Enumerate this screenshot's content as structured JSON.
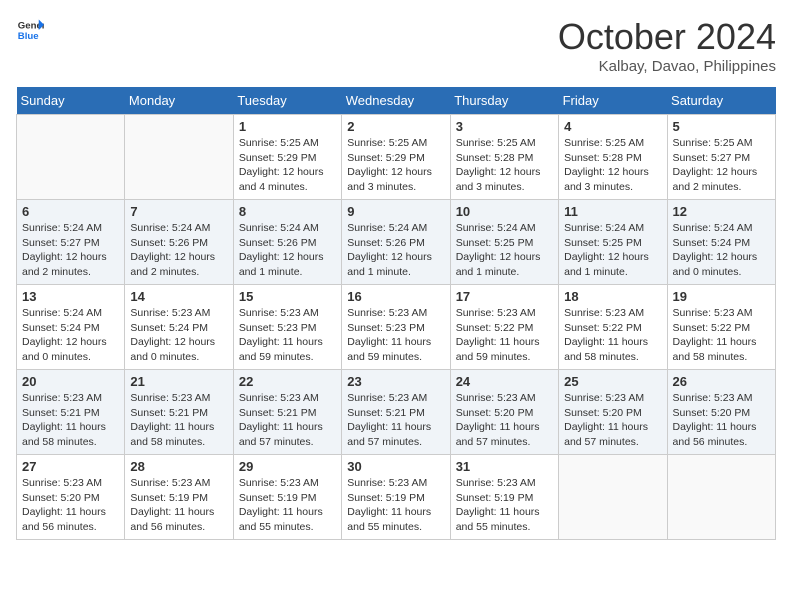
{
  "header": {
    "logo_line1": "General",
    "logo_line2": "Blue",
    "month": "October 2024",
    "location": "Kalbay, Davao, Philippines"
  },
  "weekdays": [
    "Sunday",
    "Monday",
    "Tuesday",
    "Wednesday",
    "Thursday",
    "Friday",
    "Saturday"
  ],
  "weeks": [
    [
      {
        "day": "",
        "info": ""
      },
      {
        "day": "",
        "info": ""
      },
      {
        "day": "1",
        "info": "Sunrise: 5:25 AM\nSunset: 5:29 PM\nDaylight: 12 hours and 4 minutes."
      },
      {
        "day": "2",
        "info": "Sunrise: 5:25 AM\nSunset: 5:29 PM\nDaylight: 12 hours and 3 minutes."
      },
      {
        "day": "3",
        "info": "Sunrise: 5:25 AM\nSunset: 5:28 PM\nDaylight: 12 hours and 3 minutes."
      },
      {
        "day": "4",
        "info": "Sunrise: 5:25 AM\nSunset: 5:28 PM\nDaylight: 12 hours and 3 minutes."
      },
      {
        "day": "5",
        "info": "Sunrise: 5:25 AM\nSunset: 5:27 PM\nDaylight: 12 hours and 2 minutes."
      }
    ],
    [
      {
        "day": "6",
        "info": "Sunrise: 5:24 AM\nSunset: 5:27 PM\nDaylight: 12 hours and 2 minutes."
      },
      {
        "day": "7",
        "info": "Sunrise: 5:24 AM\nSunset: 5:26 PM\nDaylight: 12 hours and 2 minutes."
      },
      {
        "day": "8",
        "info": "Sunrise: 5:24 AM\nSunset: 5:26 PM\nDaylight: 12 hours and 1 minute."
      },
      {
        "day": "9",
        "info": "Sunrise: 5:24 AM\nSunset: 5:26 PM\nDaylight: 12 hours and 1 minute."
      },
      {
        "day": "10",
        "info": "Sunrise: 5:24 AM\nSunset: 5:25 PM\nDaylight: 12 hours and 1 minute."
      },
      {
        "day": "11",
        "info": "Sunrise: 5:24 AM\nSunset: 5:25 PM\nDaylight: 12 hours and 1 minute."
      },
      {
        "day": "12",
        "info": "Sunrise: 5:24 AM\nSunset: 5:24 PM\nDaylight: 12 hours and 0 minutes."
      }
    ],
    [
      {
        "day": "13",
        "info": "Sunrise: 5:24 AM\nSunset: 5:24 PM\nDaylight: 12 hours and 0 minutes."
      },
      {
        "day": "14",
        "info": "Sunrise: 5:23 AM\nSunset: 5:24 PM\nDaylight: 12 hours and 0 minutes."
      },
      {
        "day": "15",
        "info": "Sunrise: 5:23 AM\nSunset: 5:23 PM\nDaylight: 11 hours and 59 minutes."
      },
      {
        "day": "16",
        "info": "Sunrise: 5:23 AM\nSunset: 5:23 PM\nDaylight: 11 hours and 59 minutes."
      },
      {
        "day": "17",
        "info": "Sunrise: 5:23 AM\nSunset: 5:22 PM\nDaylight: 11 hours and 59 minutes."
      },
      {
        "day": "18",
        "info": "Sunrise: 5:23 AM\nSunset: 5:22 PM\nDaylight: 11 hours and 58 minutes."
      },
      {
        "day": "19",
        "info": "Sunrise: 5:23 AM\nSunset: 5:22 PM\nDaylight: 11 hours and 58 minutes."
      }
    ],
    [
      {
        "day": "20",
        "info": "Sunrise: 5:23 AM\nSunset: 5:21 PM\nDaylight: 11 hours and 58 minutes."
      },
      {
        "day": "21",
        "info": "Sunrise: 5:23 AM\nSunset: 5:21 PM\nDaylight: 11 hours and 58 minutes."
      },
      {
        "day": "22",
        "info": "Sunrise: 5:23 AM\nSunset: 5:21 PM\nDaylight: 11 hours and 57 minutes."
      },
      {
        "day": "23",
        "info": "Sunrise: 5:23 AM\nSunset: 5:21 PM\nDaylight: 11 hours and 57 minutes."
      },
      {
        "day": "24",
        "info": "Sunrise: 5:23 AM\nSunset: 5:20 PM\nDaylight: 11 hours and 57 minutes."
      },
      {
        "day": "25",
        "info": "Sunrise: 5:23 AM\nSunset: 5:20 PM\nDaylight: 11 hours and 57 minutes."
      },
      {
        "day": "26",
        "info": "Sunrise: 5:23 AM\nSunset: 5:20 PM\nDaylight: 11 hours and 56 minutes."
      }
    ],
    [
      {
        "day": "27",
        "info": "Sunrise: 5:23 AM\nSunset: 5:20 PM\nDaylight: 11 hours and 56 minutes."
      },
      {
        "day": "28",
        "info": "Sunrise: 5:23 AM\nSunset: 5:19 PM\nDaylight: 11 hours and 56 minutes."
      },
      {
        "day": "29",
        "info": "Sunrise: 5:23 AM\nSunset: 5:19 PM\nDaylight: 11 hours and 55 minutes."
      },
      {
        "day": "30",
        "info": "Sunrise: 5:23 AM\nSunset: 5:19 PM\nDaylight: 11 hours and 55 minutes."
      },
      {
        "day": "31",
        "info": "Sunrise: 5:23 AM\nSunset: 5:19 PM\nDaylight: 11 hours and 55 minutes."
      },
      {
        "day": "",
        "info": ""
      },
      {
        "day": "",
        "info": ""
      }
    ]
  ]
}
